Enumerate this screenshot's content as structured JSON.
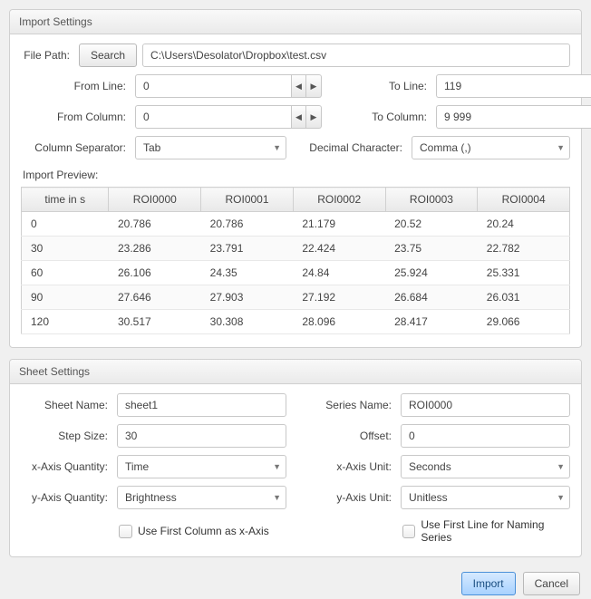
{
  "importSettings": {
    "title": "Import Settings",
    "filePathLabel": "File Path:",
    "searchBtn": "Search",
    "filePath": "C:\\Users\\Desolator\\Dropbox\\test.csv",
    "fromLineLabel": "From Line:",
    "fromLine": "0",
    "toLineLabel": "To Line:",
    "toLine": "119",
    "fromColLabel": "From Column:",
    "fromCol": "0",
    "toColLabel": "To Column:",
    "toCol": "9 999",
    "colSepLabel": "Column Separator:",
    "colSep": "Tab",
    "decCharLabel": "Decimal Character:",
    "decChar": "Comma (,)",
    "previewLabel": "Import Preview:",
    "preview": {
      "headers": [
        "time in s",
        "ROI0000",
        "ROI0001",
        "ROI0002",
        "ROI0003",
        "ROI0004"
      ],
      "rows": [
        [
          "0",
          "20.786",
          "20.786",
          "21.179",
          "20.52",
          "20.24"
        ],
        [
          "30",
          "23.286",
          "23.791",
          "22.424",
          "23.75",
          "22.782"
        ],
        [
          "60",
          "26.106",
          "24.35",
          "24.84",
          "25.924",
          "25.331"
        ],
        [
          "90",
          "27.646",
          "27.903",
          "27.192",
          "26.684",
          "26.031"
        ],
        [
          "120",
          "30.517",
          "30.308",
          "28.096",
          "28.417",
          "29.066"
        ]
      ]
    }
  },
  "sheetSettings": {
    "title": "Sheet Settings",
    "sheetNameLabel": "Sheet Name:",
    "sheetName": "sheet1",
    "seriesNameLabel": "Series Name:",
    "seriesName": "ROI0000",
    "stepSizeLabel": "Step Size:",
    "stepSize": "30",
    "offsetLabel": "Offset:",
    "offset": "0",
    "xQtyLabel": "x-Axis Quantity:",
    "xQty": "Time",
    "xUnitLabel": "x-Axis Unit:",
    "xUnit": "Seconds",
    "yQtyLabel": "y-Axis Quantity:",
    "yQty": "Brightness",
    "yUnitLabel": "y-Axis Unit:",
    "yUnit": "Unitless",
    "useFirstCol": "Use First Column as x-Axis",
    "useFirstLine": "Use First Line for Naming Series"
  },
  "footer": {
    "import": "Import",
    "cancel": "Cancel"
  }
}
